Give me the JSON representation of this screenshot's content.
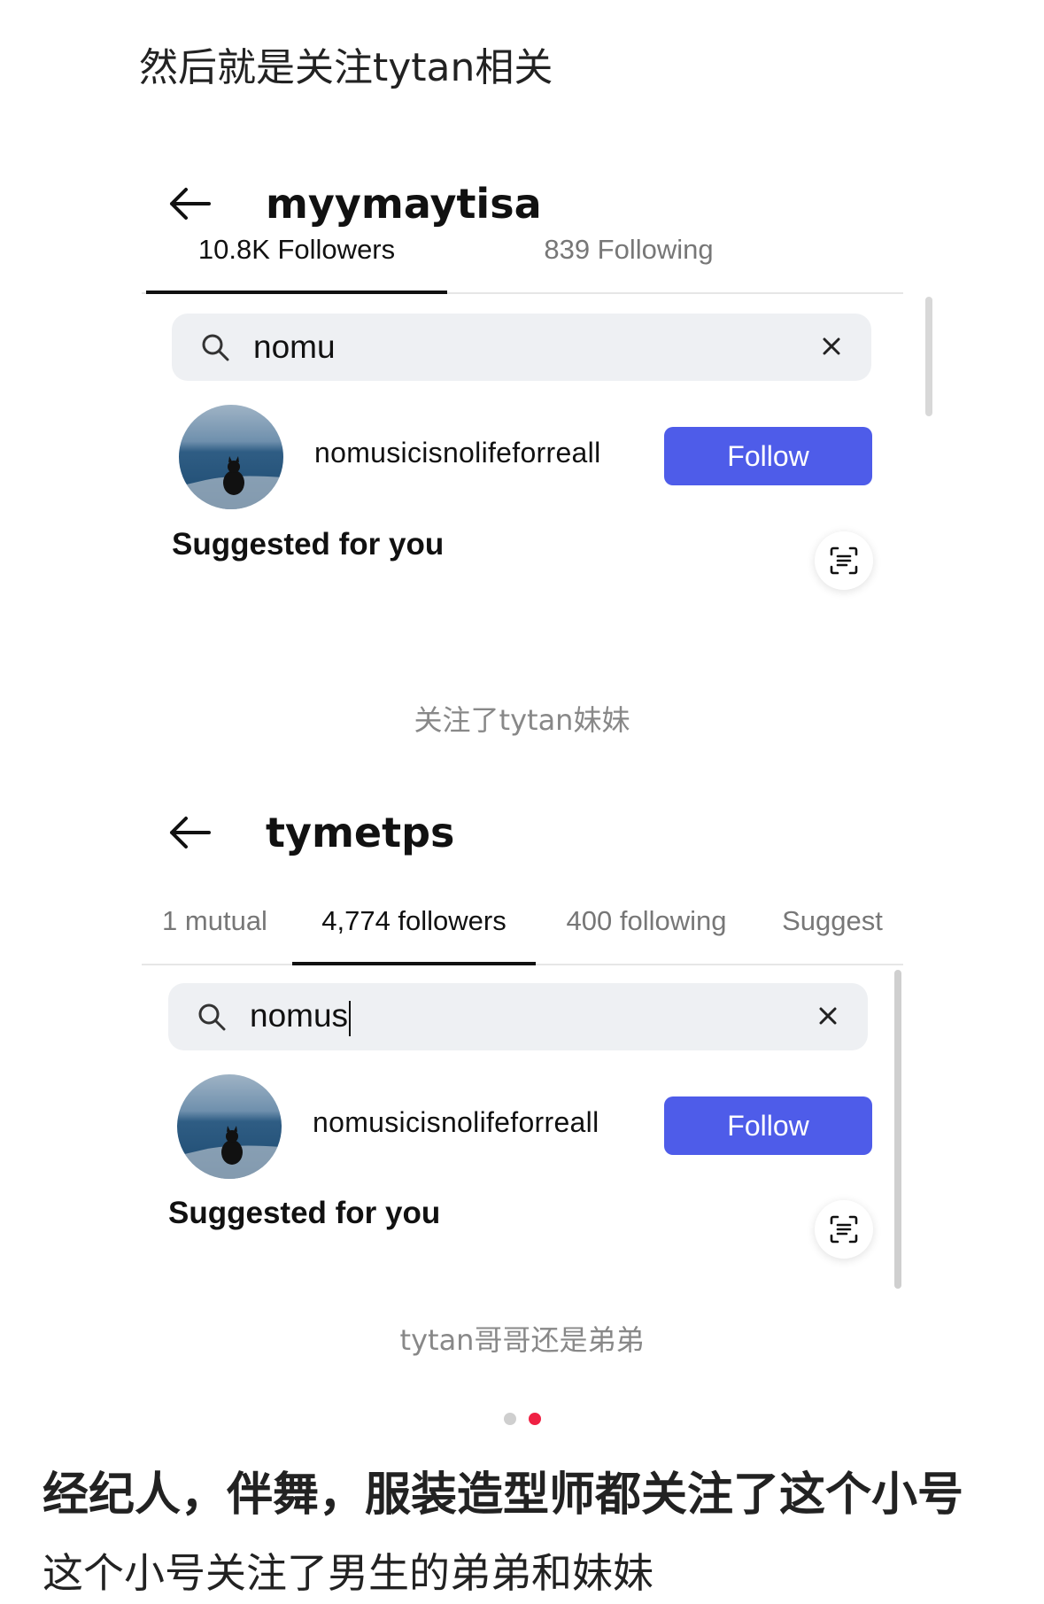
{
  "caption_top": "然后就是关注tytan相关",
  "screens": [
    {
      "title": "myymaytisa",
      "tabs": [
        "10.8K Followers",
        "839 Following"
      ],
      "search_value": "nomu",
      "result_username": "nomusicisnolifeforreall",
      "follow_label": "Follow",
      "suggested_label": "Suggested for you",
      "caption": "关注了tytan妹妹"
    },
    {
      "title": "tymetps",
      "tabs": [
        "1 mutual",
        "4,774 followers",
        "400 following",
        "Suggest"
      ],
      "search_value": "nomus",
      "result_username": "nomusicisnolifeforreall",
      "follow_label": "Follow",
      "suggested_label": "Suggested for you",
      "caption": "tytan哥哥还是弟弟"
    }
  ],
  "pagination": {
    "total": 2,
    "active": 2
  },
  "body_bold": "经纪人，伴舞，服装造型师都关注了这个小号",
  "body_text": "这个小号关注了男生的弟弟和妹妹",
  "colors": {
    "follow_button": "#4e5ce9",
    "active_dot": "#ef2143"
  },
  "icons": [
    "back-arrow-icon",
    "search-icon",
    "close-icon",
    "scan-icon"
  ]
}
